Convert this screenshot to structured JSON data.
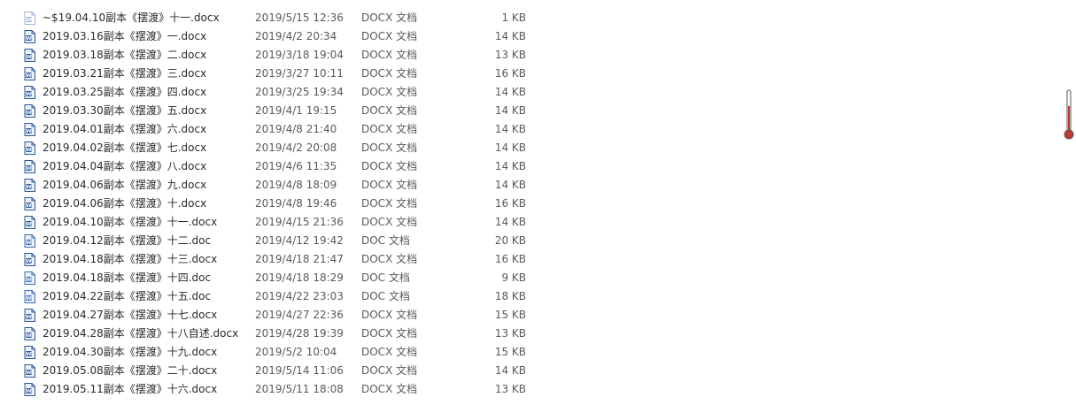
{
  "files": [
    {
      "name": "~$19.04.10副本《摆渡》十一.docx",
      "date": "2019/5/15 12:36",
      "type": "DOCX 文档",
      "size": "1 KB",
      "icon": "word-temp-file-icon"
    },
    {
      "name": "2019.03.16副本《摆渡》一.docx",
      "date": "2019/4/2 20:34",
      "type": "DOCX 文档",
      "size": "14 KB",
      "icon": "word-docx-icon"
    },
    {
      "name": "2019.03.18副本《摆渡》二.docx",
      "date": "2019/3/18 19:04",
      "type": "DOCX 文档",
      "size": "13 KB",
      "icon": "word-docx-icon"
    },
    {
      "name": "2019.03.21副本《摆渡》三.docx",
      "date": "2019/3/27 10:11",
      "type": "DOCX 文档",
      "size": "16 KB",
      "icon": "word-docx-icon"
    },
    {
      "name": "2019.03.25副本《摆渡》四.docx",
      "date": "2019/3/25 19:34",
      "type": "DOCX 文档",
      "size": "14 KB",
      "icon": "word-docx-icon"
    },
    {
      "name": "2019.03.30副本《摆渡》五.docx",
      "date": "2019/4/1 19:15",
      "type": "DOCX 文档",
      "size": "14 KB",
      "icon": "word-docx-icon"
    },
    {
      "name": "2019.04.01副本《摆渡》六.docx",
      "date": "2019/4/8 21:40",
      "type": "DOCX 文档",
      "size": "14 KB",
      "icon": "word-docx-icon"
    },
    {
      "name": "2019.04.02副本《摆渡》七.docx",
      "date": "2019/4/2 20:08",
      "type": "DOCX 文档",
      "size": "14 KB",
      "icon": "word-docx-icon"
    },
    {
      "name": "2019.04.04副本《摆渡》八.docx",
      "date": "2019/4/6 11:35",
      "type": "DOCX 文档",
      "size": "14 KB",
      "icon": "word-docx-icon"
    },
    {
      "name": "2019.04.06副本《摆渡》九.docx",
      "date": "2019/4/8 18:09",
      "type": "DOCX 文档",
      "size": "14 KB",
      "icon": "word-docx-icon"
    },
    {
      "name": "2019.04.06副本《摆渡》十.docx",
      "date": "2019/4/8 19:46",
      "type": "DOCX 文档",
      "size": "16 KB",
      "icon": "word-docx-icon"
    },
    {
      "name": "2019.04.10副本《摆渡》十一.docx",
      "date": "2019/4/15 21:36",
      "type": "DOCX 文档",
      "size": "14 KB",
      "icon": "word-docx-icon"
    },
    {
      "name": "2019.04.12副本《摆渡》十二.doc",
      "date": "2019/4/12 19:42",
      "type": "DOC 文档",
      "size": "20 KB",
      "icon": "word-doc-icon"
    },
    {
      "name": "2019.04.18副本《摆渡》十三.docx",
      "date": "2019/4/18 21:47",
      "type": "DOCX 文档",
      "size": "16 KB",
      "icon": "word-docx-icon"
    },
    {
      "name": "2019.04.18副本《摆渡》十四.doc",
      "date": "2019/4/18 18:29",
      "type": "DOC 文档",
      "size": "9 KB",
      "icon": "word-doc-icon"
    },
    {
      "name": "2019.04.22副本《摆渡》十五.doc",
      "date": "2019/4/22 23:03",
      "type": "DOC 文档",
      "size": "18 KB",
      "icon": "word-doc-icon"
    },
    {
      "name": "2019.04.27副本《摆渡》十七.docx",
      "date": "2019/4/27 22:36",
      "type": "DOCX 文档",
      "size": "15 KB",
      "icon": "word-docx-icon"
    },
    {
      "name": "2019.04.28副本《摆渡》十八自述.docx",
      "date": "2019/4/28 19:39",
      "type": "DOCX 文档",
      "size": "13 KB",
      "icon": "word-docx-icon"
    },
    {
      "name": "2019.04.30副本《摆渡》十九.docx",
      "date": "2019/5/2 10:04",
      "type": "DOCX 文档",
      "size": "15 KB",
      "icon": "word-docx-icon"
    },
    {
      "name": "2019.05.08副本《摆渡》二十.docx",
      "date": "2019/5/14 11:06",
      "type": "DOCX 文档",
      "size": "14 KB",
      "icon": "word-docx-icon"
    },
    {
      "name": "2019.05.11副本《摆渡》十六.docx",
      "date": "2019/5/11 18:08",
      "type": "DOCX 文档",
      "size": "13 KB",
      "icon": "word-docx-icon"
    }
  ],
  "colors": {
    "icon_docx": "#2b5797",
    "icon_doc": "#3c6db4",
    "icon_temp": "#9bb3d6",
    "scroll_indicator": "#c0392b"
  },
  "scroll_indicator_icon": "thermometer-scroll-indicator-icon"
}
